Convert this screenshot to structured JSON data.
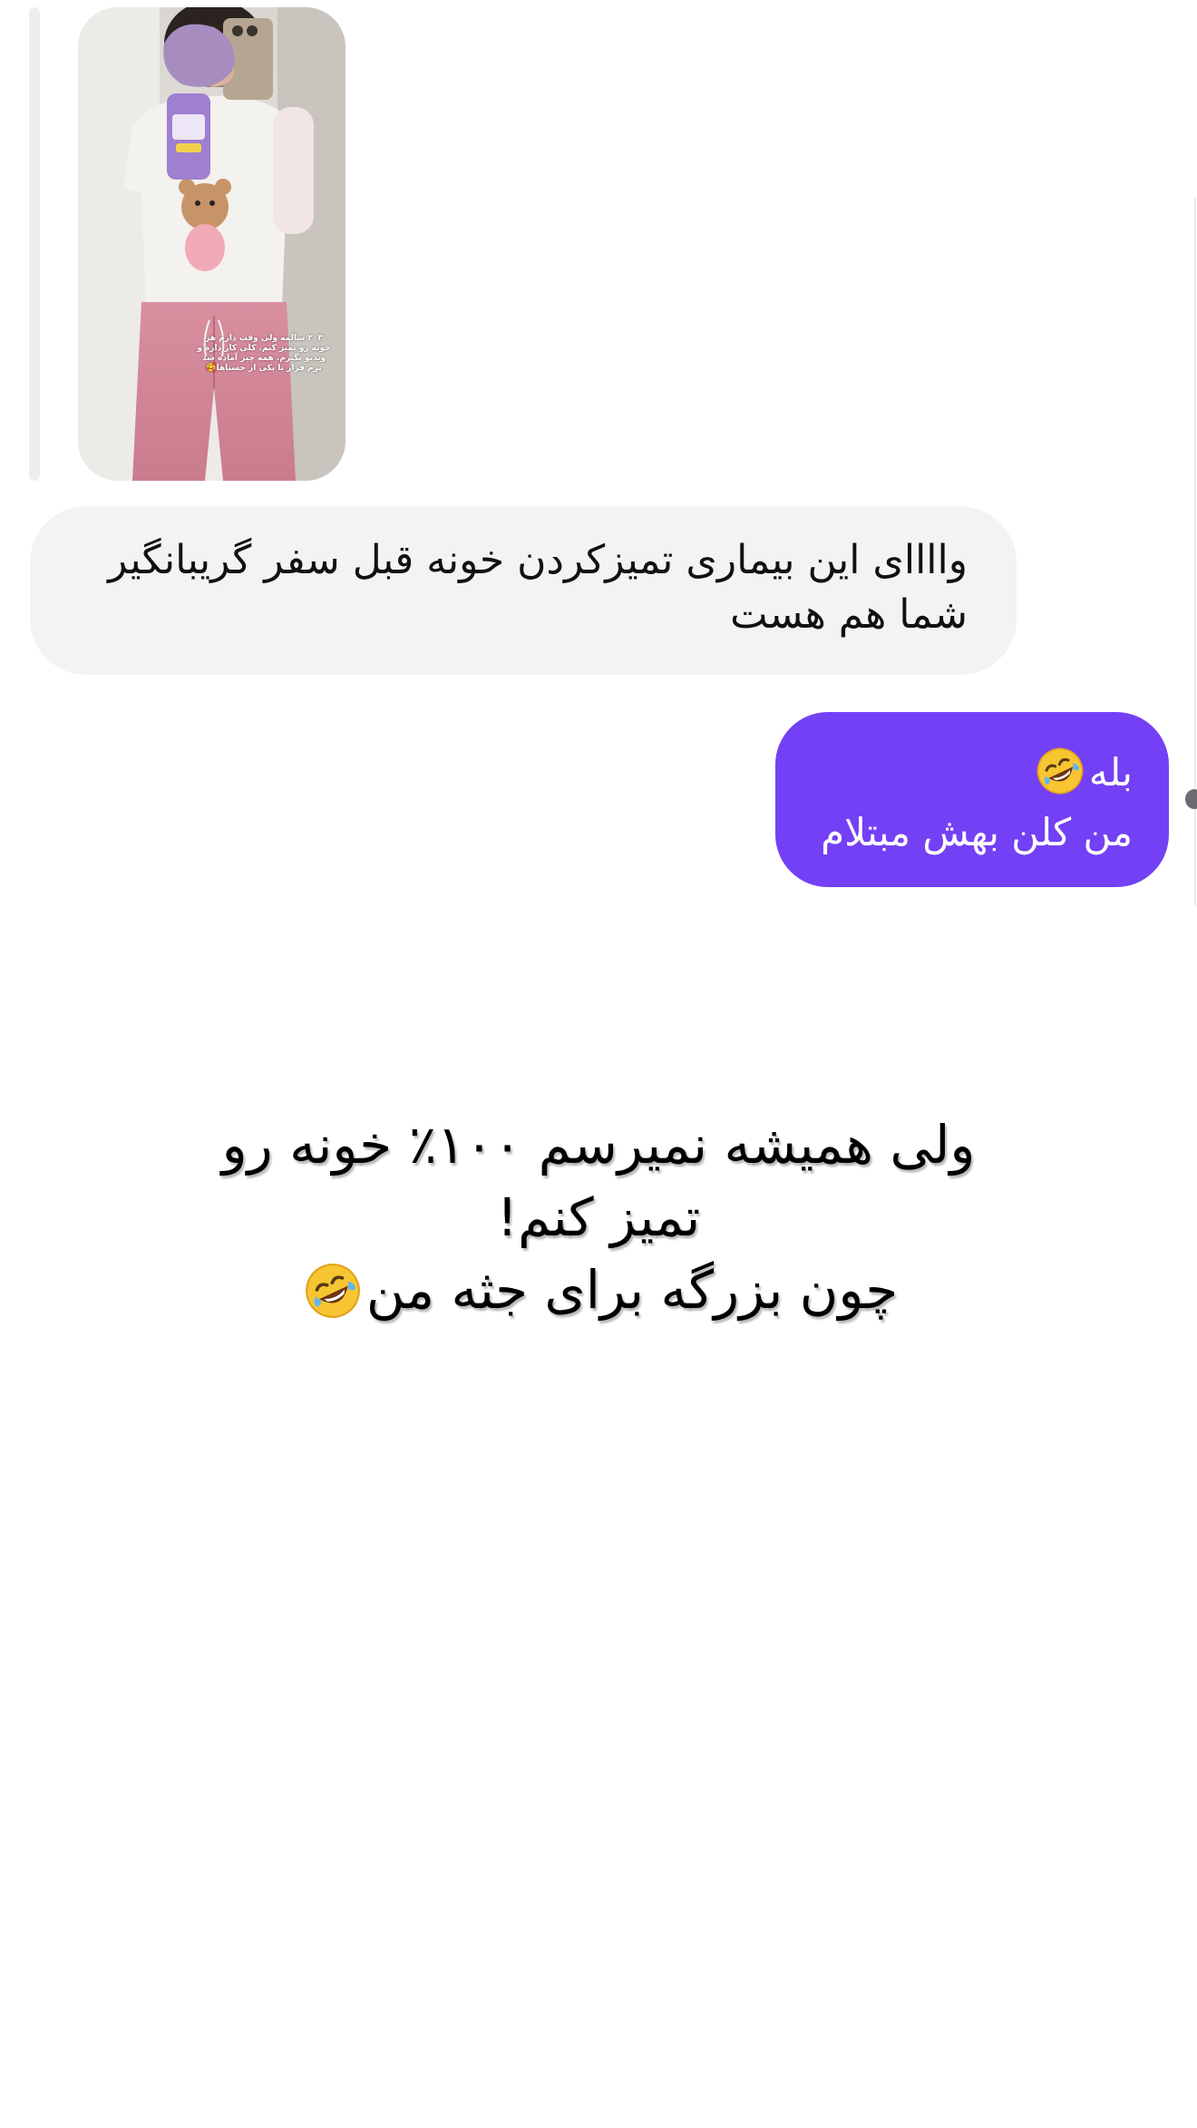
{
  "story_reply": {
    "caption": "۲۰۳ سالمه ولی وقت دارم هر خونه رو تمیز کنم. کلی کار داره و ویدیو بگیرم. همه چیز آماده شد برم فرار با یکی از خستاها🥰"
  },
  "messages": {
    "incoming": {
      "text": "واااای این بیماری تمیزکردن خونه قبل سفر گریبانگیر شما هم هست"
    },
    "outgoing": {
      "line1": "بله",
      "line2": "من کلن بهش مبتلام",
      "emoji": "rolling-on-floor-laughing-emoji"
    }
  },
  "overlay": {
    "line1": "ولی همیشه نمیرسم ۱۰۰٪ خونه رو",
    "line2": "تمیز کنم!",
    "line3": "چون بزرگه برای جثه من",
    "emoji": "rolling-on-floor-laughing-emoji"
  },
  "colors": {
    "outgoing_bubble": "#7440f5",
    "incoming_bubble": "#f2f3f5",
    "text_dark": "#111111"
  }
}
